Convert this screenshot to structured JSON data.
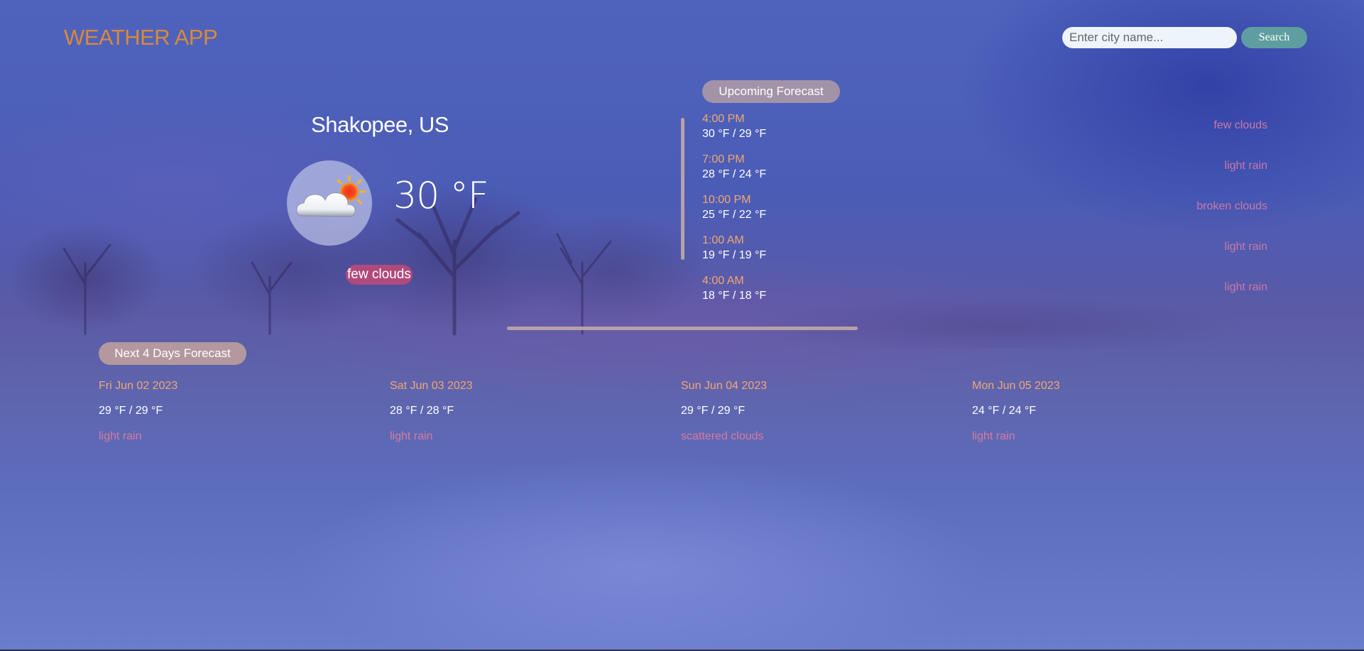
{
  "header": {
    "brand": "WEATHER APP",
    "search_placeholder": "Enter city name...",
    "search_button": "Search"
  },
  "current": {
    "city": "Shakopee, US",
    "temperature": "30 °F",
    "condition": "few clouds",
    "icon": "few-clouds-day-icon"
  },
  "upcoming": {
    "title": "Upcoming Forecast",
    "items": [
      {
        "time": "4:00 PM",
        "temps": "30 °F / 29 °F",
        "desc": "few clouds"
      },
      {
        "time": "7:00 PM",
        "temps": "28 °F / 24 °F",
        "desc": "light rain"
      },
      {
        "time": "10:00 PM",
        "temps": "25 °F / 22 °F",
        "desc": "broken clouds"
      },
      {
        "time": "1:00 AM",
        "temps": "19 °F / 19 °F",
        "desc": "light rain"
      },
      {
        "time": "4:00 AM",
        "temps": "18 °F / 18 °F",
        "desc": "light rain"
      }
    ]
  },
  "next_days": {
    "title": "Next 4 Days Forecast",
    "items": [
      {
        "date": "Fri Jun 02 2023",
        "temps": "29 °F / 29 °F",
        "desc": "light rain"
      },
      {
        "date": "Sat Jun 03 2023",
        "temps": "28 °F / 28 °F",
        "desc": "light rain"
      },
      {
        "date": "Sun Jun 04 2023",
        "temps": "29 °F / 29 °F",
        "desc": "scattered clouds"
      },
      {
        "date": "Mon Jun 05 2023",
        "temps": "24 °F / 24 °F",
        "desc": "light rain"
      }
    ]
  },
  "colors": {
    "brand": "#d9893a",
    "accent_time": "#f0a871",
    "search_button": "#5e9ea0",
    "condition_badge": "#b04a7c"
  }
}
